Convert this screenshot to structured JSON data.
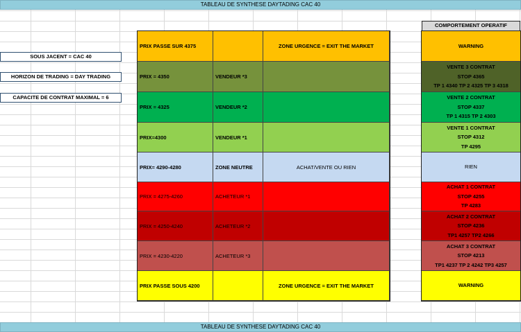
{
  "banner": {
    "top_title": "TABLEAU DE SYNTHESE DAYTADING CAC 40",
    "bottom_title": "TABLEAU DE SYNTHESE DAYTADING CAC 40"
  },
  "info_boxes": [
    "SOUS JACENT = CAC 40",
    "HORIZON DE TRADING = DAY TRADING",
    "CAPACITE DE CONTRAT MAXIMAL = 6"
  ],
  "comportement_header": "COMPORTEMENT OPERATIF",
  "colors": {
    "banner": "#92cddc",
    "orange": "#ffc000",
    "olive": "#76923c",
    "green": "#00b050",
    "light_green": "#92d050",
    "light_blue": "#c5d9f1",
    "red": "#ff0000",
    "dark_red": "#c00000",
    "rose": "#c0504d",
    "yellow": "#ffff00",
    "dark_olive": "#4f6228"
  },
  "rows": [
    {
      "price": "PRIX PASSE SUR 4375",
      "position": "",
      "zone": "ZONE URGENCE = EXIT THE MARKET",
      "lines": [
        "WARNING"
      ]
    },
    {
      "price": "PRIX = 4350",
      "position": "VENDEUR *3",
      "zone": "",
      "lines": [
        "VENTE 3 CONTRAT",
        "STOP 4365",
        "TP 1  4340  TP 2 4325  TP 3  4318"
      ]
    },
    {
      "price": "PRIX = 4325",
      "position": "VENDEUR *2",
      "zone": "",
      "lines": [
        "VENTE 2 CONTRAT",
        "STOP 4337",
        "TP 1  4315  TP 2 4303"
      ]
    },
    {
      "price": "PRIX=4300",
      "position": "VENDEUR *1",
      "zone": "",
      "lines": [
        "VENTE 1 CONTRAT",
        "STOP 4312",
        "TP 4295"
      ]
    },
    {
      "price": "PRIX= 4290-4280",
      "position": "ZONE NEUTRE",
      "zone": "ACHAT/VENTE OU RIEN",
      "lines": [
        "RIEN"
      ]
    },
    {
      "price": "PRIX = 4275-4260",
      "position": "ACHETEUR *1",
      "zone": "",
      "lines": [
        "ACHAT 1 CONTRAT",
        "STOP 4255",
        "TP 4283"
      ]
    },
    {
      "price": "PRIX = 4250-4240",
      "position": "ACHETEUR *2",
      "zone": "",
      "lines": [
        "ACHAT 2 CONTRAT",
        "STOP 4236",
        "TP1 4257 TP2 4266"
      ]
    },
    {
      "price": "PRIX = 4230-4220",
      "position": "ACHETEUR *3",
      "zone": "",
      "lines": [
        "ACHAT 3 CONTRAT",
        "STOP 4213",
        "TP1 4237 TP 2 4242 TP3 4257"
      ]
    },
    {
      "price": "PRIX PASSE SOUS 4200",
      "position": "",
      "zone": "ZONE URGENCE = EXIT THE MARKET",
      "lines": [
        "WARNING"
      ]
    }
  ]
}
